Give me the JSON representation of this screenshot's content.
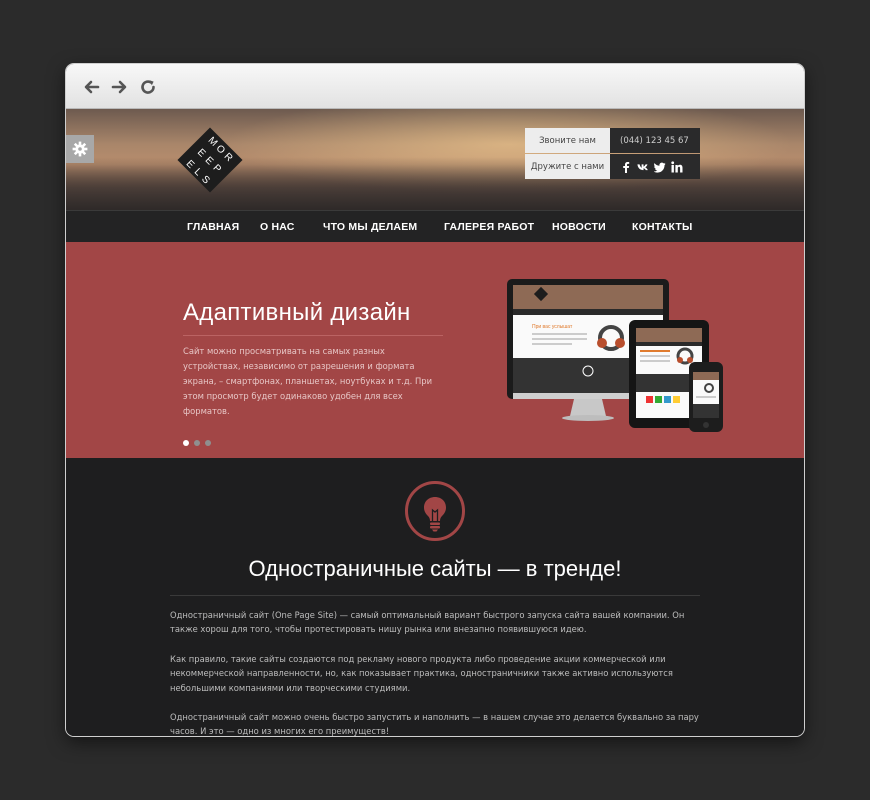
{
  "browser": {
    "back_icon": "arrow-left-icon",
    "forward_icon": "arrow-right-icon",
    "reload_icon": "reload-icon"
  },
  "header": {
    "logo_letters": [
      "M",
      "O",
      "R",
      "E",
      "E",
      "P",
      "E",
      "L",
      "S"
    ],
    "settings_icon": "gear-icon",
    "contact": {
      "call_label": "Звоните нам",
      "phone": "(044) 123 45 67",
      "friends_label": "Дружите с нами",
      "social_icons": [
        "facebook-icon",
        "vk-icon",
        "twitter-icon",
        "linkedin-icon"
      ]
    }
  },
  "menu": {
    "items": [
      {
        "label": "ГЛАВНАЯ"
      },
      {
        "label": "О НАС"
      },
      {
        "label": "ЧТО МЫ ДЕЛАЕМ"
      },
      {
        "label": "ГАЛЕРЕЯ РАБОТ"
      },
      {
        "label": "НОВОСТИ"
      },
      {
        "label": "КОНТАКТЫ"
      }
    ]
  },
  "slider": {
    "title": "Адаптивный дизайн",
    "text": "Сайт можно просматривать на самых разных устройствах, независимо от разрешения и формата экрана, – смартфонах, планшетах, ноутбуках и т.д. При этом просмотр будет одинаково удобен для всех форматов.",
    "dots": {
      "count": 3,
      "active": 1
    },
    "device_screen_text": "При вас услышат"
  },
  "content": {
    "icon": "lightbulb-icon",
    "title": "Одностраничные сайты — в тренде!",
    "paragraphs": [
      "Одностраничный сайт (One Page Site) — самый оптимальный вариант быстрого запуска сайта вашей компании. Он также хорош для того, чтобы протестировать нишу рынка или внезапно появившуюся идею.",
      "Как правило, такие сайты создаются под рекламу нового продукта либо проведение акции коммерческой или некоммерческой направленности, но, как показывает практика, одностраничники также активно используются небольшими компаниями или творческими студиями.",
      "Одностраничный сайт можно очень быстро запустить и наполнить — в нашем случае это делается буквально за пару часов. И это — одно из многих его преимуществ!"
    ]
  },
  "colors": {
    "accent": "#a24646",
    "nav_bg": "#232324",
    "content_bg": "#1e1e1f"
  }
}
